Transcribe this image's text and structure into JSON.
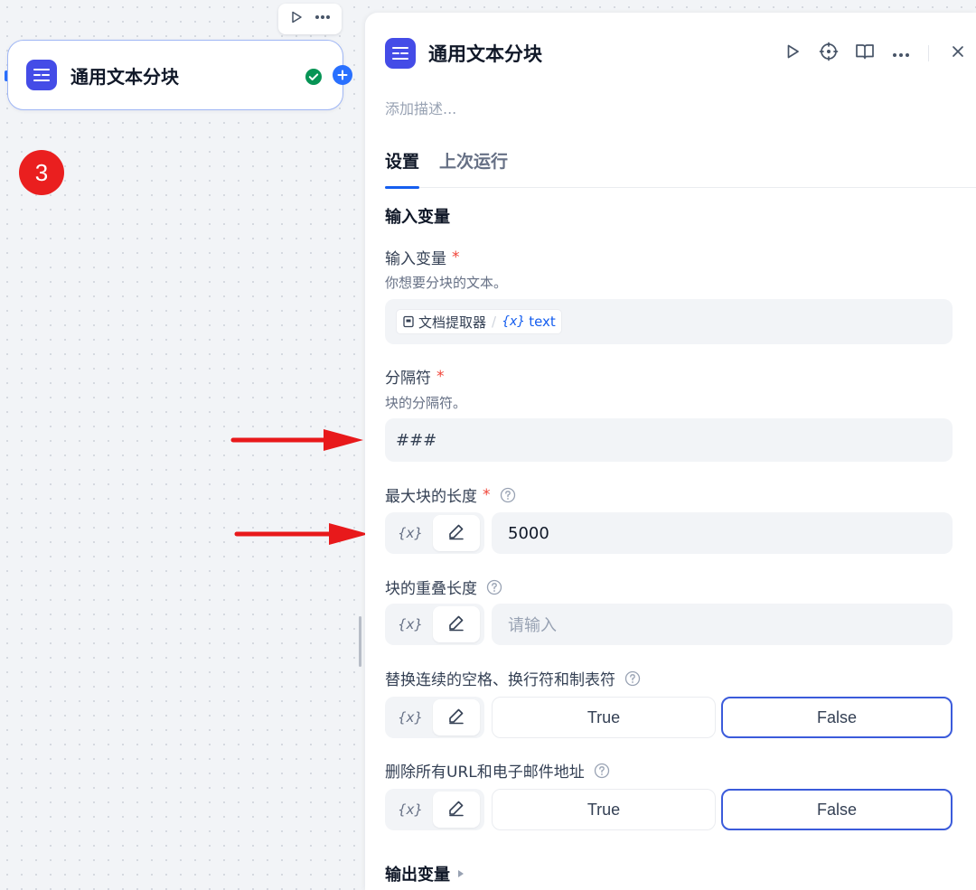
{
  "node": {
    "title": "通用文本分块",
    "step_number": "3"
  },
  "panel": {
    "title": "通用文本分块",
    "description_placeholder": "添加描述...",
    "tabs": [
      "设置",
      "上次运行"
    ],
    "section_input_title": "输入变量",
    "fields": {
      "input_var": {
        "label": "输入变量",
        "required_mark": "*",
        "desc": "你想要分块的文本。",
        "source_node": "文档提取器",
        "var_symbol": "{x}",
        "var_name": "text"
      },
      "delimiter": {
        "label": "分隔符",
        "required_mark": "*",
        "desc": "块的分隔符。",
        "value": "###"
      },
      "max_chunk_length": {
        "label": "最大块的长度",
        "required_mark": "*",
        "value": "5000"
      },
      "chunk_overlap": {
        "label": "块的重叠长度",
        "placeholder": "请输入"
      },
      "replace_whitespace": {
        "label": "替换连续的空格、换行符和制表符",
        "options": [
          "True",
          "False"
        ],
        "selected": "False"
      },
      "remove_urls": {
        "label": "删除所有URL和电子邮件地址",
        "options": [
          "True",
          "False"
        ],
        "selected": "False"
      }
    },
    "mode_var_symbol": "{x}",
    "section_output_title": "输出变量"
  },
  "colors": {
    "accent": "#155eef",
    "app_icon": "#444ce7",
    "required": "#f04438",
    "arrow": "#e8191b",
    "badge": "#ea1f1f"
  },
  "icons": [
    "play-icon",
    "more-icon",
    "app-chunk-icon",
    "check-circle-icon",
    "plus-icon",
    "locate-icon",
    "book-icon",
    "close-icon",
    "help-icon",
    "pen-icon",
    "doc-icon",
    "caret-right-icon"
  ]
}
